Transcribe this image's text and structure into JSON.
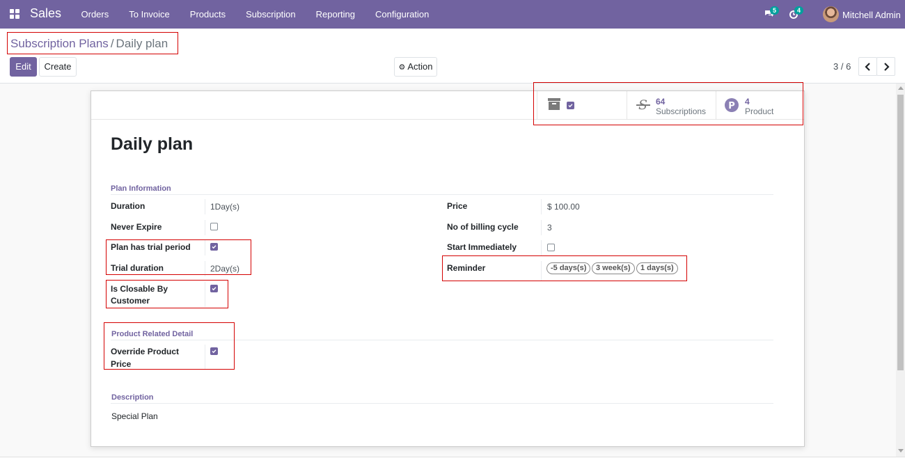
{
  "navbar": {
    "app_name": "Sales",
    "menu": [
      "Orders",
      "To Invoice",
      "Products",
      "Subscription",
      "Reporting",
      "Configuration"
    ],
    "messages_count": "5",
    "activities_count": "4",
    "user_name": "Mitchell Admin",
    "bg_color": "#7163a0"
  },
  "breadcrumb": {
    "parent": "Subscription Plans",
    "separator": "/",
    "current": "Daily plan"
  },
  "toolbar": {
    "edit_label": "Edit",
    "create_label": "Create",
    "action_label": "Action",
    "pager_value": "3 / 6"
  },
  "button_box": {
    "archive_icon": "archive-icon",
    "subscriptions_count": "64",
    "subscriptions_label": "Subscriptions",
    "product_count": "4",
    "product_label": "Product"
  },
  "record": {
    "title": "Daily plan",
    "plan_info_title": "Plan Information",
    "duration_label": "Duration",
    "duration_value": "1Day(s)",
    "never_expire_label": "Never Expire",
    "never_expire_checked": false,
    "trial_label": "Plan has trial period",
    "trial_checked": true,
    "trial_duration_label": "Trial duration",
    "trial_duration_value": "2Day(s)",
    "closable_label_1": "Is Closable By",
    "closable_label_2": "Customer",
    "closable_checked": true,
    "price_label": "Price",
    "price_value": "$ 100.00",
    "billing_cycle_label": "No of billing cycle",
    "billing_cycle_value": "3",
    "start_immediately_label": "Start Immediately",
    "start_immediately_checked": false,
    "reminder_label": "Reminder",
    "reminder_tags": [
      "-5 days(s)",
      "3 week(s)",
      "1 days(s)"
    ],
    "product_detail_title": "Product Related Detail",
    "override_label_1": "Override Product",
    "override_label_2": "Price",
    "override_checked": true,
    "description_title": "Description",
    "description_value": "Special Plan"
  },
  "colors": {
    "accent": "#7163a0",
    "highlight_box": "#d40000",
    "badge": "#00a09d"
  }
}
